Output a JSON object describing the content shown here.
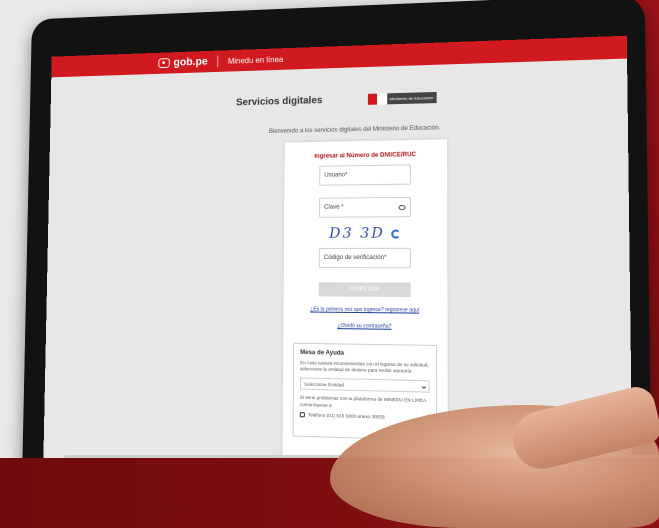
{
  "topbar": {
    "logo_text": "gob.pe",
    "subtitle": "Minedu en línea"
  },
  "header": {
    "title": "Servicios digitales",
    "badge_text": "Ministerio de Educación"
  },
  "welcome": "Bienvenido a los servicios digitales del Ministerio de Educación.",
  "login": {
    "heading": "Ingresar al Número de DNI/CE/RUC",
    "user_label": "Usuario*",
    "password_label": "Clave *",
    "captcha_text": "D3 3D",
    "code_label": "Código de verificación*",
    "submit_label": "INGRESAR",
    "register_link": "¿Es la primera vez que ingresa? registrese aquí",
    "forgot_link": "¿Olvidó su contraseña?"
  },
  "help": {
    "title": "Mesa de Ayuda",
    "text": "En caso tuviera inconvenientes con el ingreso de su solicitud, seleccione la entidad de destino para recibir asesoría",
    "select_value": "Seleccione Entidad",
    "note": "Si tiene problemas con la plataforma de MINEDU EN LÍNEA, comuníquese a",
    "phone": "Teléfono (01) 615 5800 anexo 30505"
  },
  "colors": {
    "brand_red": "#d11a1f",
    "link_blue": "#1f3f9c"
  }
}
